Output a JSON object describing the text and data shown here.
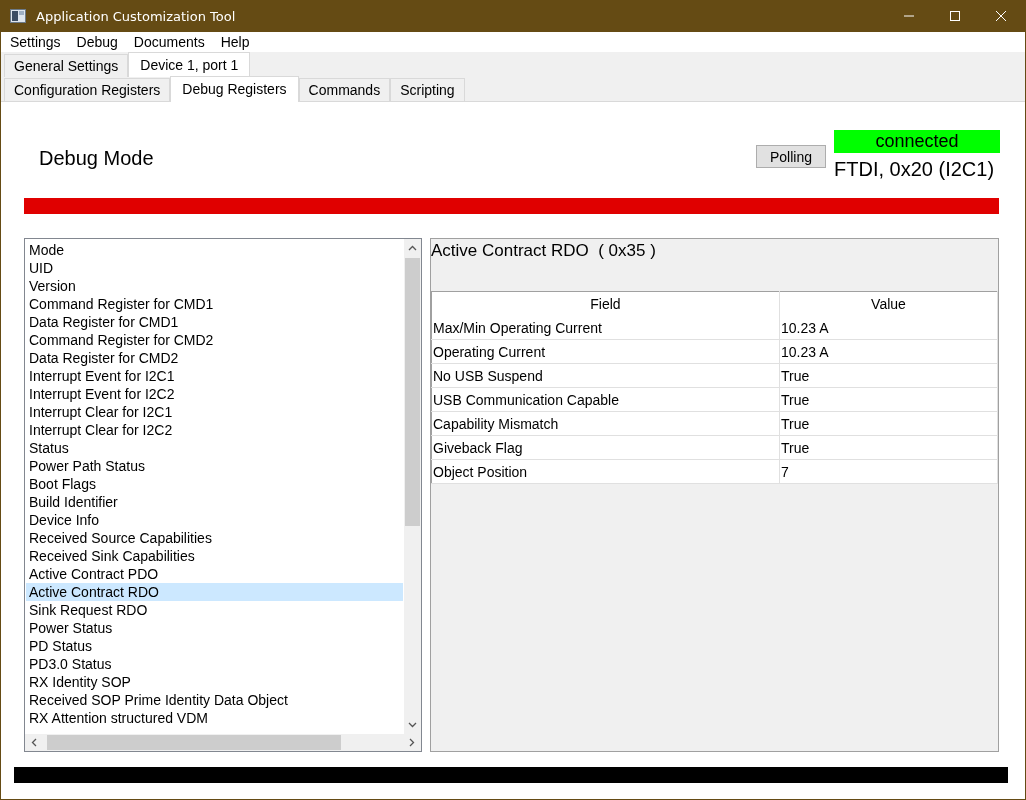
{
  "window": {
    "title": "Application Customization Tool"
  },
  "menu": [
    "Settings",
    "Debug",
    "Documents",
    "Help"
  ],
  "top_tabs": [
    {
      "label": "General Settings",
      "selected": false
    },
    {
      "label": "Device 1, port 1",
      "selected": true
    }
  ],
  "sub_tabs": [
    {
      "label": "Configuration Registers",
      "selected": false
    },
    {
      "label": "Debug Registers",
      "selected": true
    },
    {
      "label": "Commands",
      "selected": false
    },
    {
      "label": "Scripting",
      "selected": false
    }
  ],
  "header": {
    "title": "Debug Mode",
    "polling_button": "Polling",
    "connection_status": "connected",
    "connection_info": "FTDI, 0x20 (I2C1)"
  },
  "registers": [
    {
      "label": "Mode",
      "selected": false
    },
    {
      "label": "UID",
      "selected": false
    },
    {
      "label": "Version",
      "selected": false
    },
    {
      "label": "Command Register for CMD1",
      "selected": false
    },
    {
      "label": "Data Register for CMD1",
      "selected": false
    },
    {
      "label": "Command Register for CMD2",
      "selected": false
    },
    {
      "label": "Data Register for CMD2",
      "selected": false
    },
    {
      "label": "Interrupt Event for I2C1",
      "selected": false
    },
    {
      "label": "Interrupt Event for I2C2",
      "selected": false
    },
    {
      "label": "Interrupt Clear for I2C1",
      "selected": false
    },
    {
      "label": "Interrupt Clear for I2C2",
      "selected": false
    },
    {
      "label": "Status",
      "selected": false
    },
    {
      "label": "Power Path Status",
      "selected": false
    },
    {
      "label": "Boot Flags",
      "selected": false
    },
    {
      "label": "Build Identifier",
      "selected": false
    },
    {
      "label": "Device Info",
      "selected": false
    },
    {
      "label": "Received Source Capabilities",
      "selected": false
    },
    {
      "label": "Received Sink Capabilities",
      "selected": false
    },
    {
      "label": "Active Contract PDO",
      "selected": false
    },
    {
      "label": "Active Contract RDO",
      "selected": true
    },
    {
      "label": "Sink Request RDO",
      "selected": false
    },
    {
      "label": "Power Status",
      "selected": false
    },
    {
      "label": "PD Status",
      "selected": false
    },
    {
      "label": "PD3.0 Status",
      "selected": false
    },
    {
      "label": "RX Identity SOP",
      "selected": false
    },
    {
      "label": "Received SOP Prime Identity Data Object",
      "selected": false
    },
    {
      "label": "RX Attention structured VDM",
      "selected": false
    }
  ],
  "detail": {
    "title": "Active Contract RDO  ( 0x35 )",
    "columns": [
      "Field",
      "Value"
    ],
    "rows": [
      [
        "Max/Min Operating Current",
        "10.23 A"
      ],
      [
        "Operating Current",
        "10.23 A"
      ],
      [
        "No USB Suspend",
        "True"
      ],
      [
        "USB Communication Capable",
        "True"
      ],
      [
        "Capability Mismatch",
        "True"
      ],
      [
        "Giveback Flag",
        "True"
      ],
      [
        "Object Position",
        "7"
      ]
    ]
  }
}
